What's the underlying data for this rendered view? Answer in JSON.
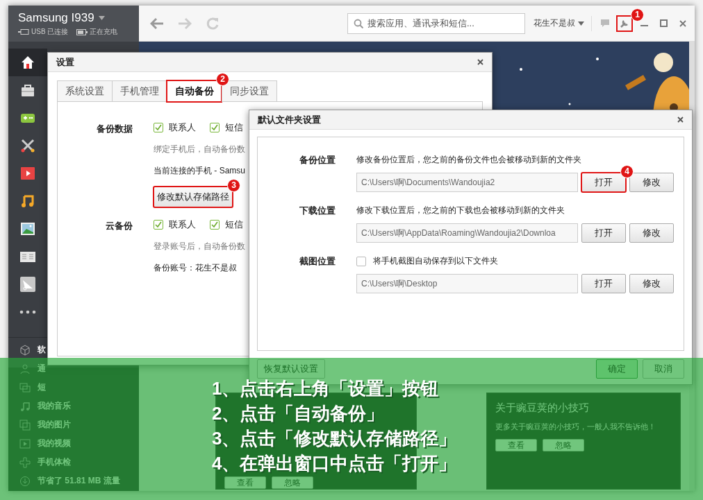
{
  "device": {
    "name": "Samsung I939",
    "usb_status": "USB 已连接",
    "charge_status": "正在充电"
  },
  "sidebar": {
    "nav": [
      {
        "selected": true
      },
      {
        "selected": false
      },
      {
        "selected": false
      },
      {
        "selected": false
      },
      {
        "selected": false
      },
      {
        "selected": false
      },
      {
        "selected": false
      },
      {
        "selected": false
      },
      {
        "selected": false
      },
      {
        "selected": false
      }
    ],
    "menu": [
      "软",
      "通",
      "短",
      "我的音乐",
      "我的图片",
      "我的视频",
      "手机体检"
    ],
    "traffic_saved": "节省了 51.81 MB 流量"
  },
  "home": {
    "card_buttons": [
      "查看",
      "忽略"
    ],
    "tip": {
      "title": "关于豌豆荚的小技巧",
      "text": "更多关于豌豆荚的小技巧，一般人我不告诉他！",
      "buttons": [
        "查看",
        "忽略"
      ]
    }
  },
  "toolbar": {
    "search": {
      "placeholder": "搜索应用、通讯录和短信..."
    },
    "account": "花生不是叔",
    "settings_button": {
      "callout": "1"
    }
  },
  "settings_dialog": {
    "title": "设置",
    "tabs": [
      {
        "label": "系统设置",
        "selected": false
      },
      {
        "label": "手机管理",
        "selected": false
      },
      {
        "label": "自动备份",
        "selected": true,
        "callout": "2"
      },
      {
        "label": "同步设置",
        "selected": false
      }
    ],
    "sections": [
      {
        "label": "备份数据",
        "options": [
          {
            "label": "联系人",
            "checked": true
          },
          {
            "label": "短信",
            "checked": true
          }
        ],
        "lines": [
          {
            "kind": "hint",
            "text": "绑定手机后，自动备份数"
          },
          {
            "kind": "info",
            "text": "当前连接的手机 - Samsu"
          }
        ],
        "button": {
          "label": "修改默认存储路径",
          "callout": "3"
        }
      },
      {
        "label": "云备份",
        "options": [
          {
            "label": "联系人",
            "checked": true
          },
          {
            "label": "短信",
            "checked": true
          }
        ],
        "lines": [
          {
            "kind": "hint",
            "text": "登录账号后，自动备份数"
          },
          {
            "kind": "info",
            "text": "备份账号：花生不是叔"
          }
        ]
      }
    ]
  },
  "folder_dialog": {
    "title": "默认文件夹设置",
    "rows": [
      {
        "label": "备份位置",
        "kind": "note",
        "note": "修改备份位置后，您之前的备份文件也会被移动到新的文件夹",
        "path": "C:\\Users\\啊\\Documents\\Wandoujia2",
        "open": {
          "label": "打开",
          "callout": "4"
        },
        "change": "修改"
      },
      {
        "label": "下载位置",
        "kind": "note",
        "note": "修改下载位置后，您之前的下载也会被移动到新的文件夹",
        "path": "C:\\Users\\啊\\AppData\\Roaming\\Wandoujia2\\Downloa",
        "open": {
          "label": "打开"
        },
        "change": "修改"
      },
      {
        "label": "截图位置",
        "kind": "checkbox",
        "checked": false,
        "note": "将手机截图自动保存到以下文件夹",
        "path": "C:\\Users\\啊\\Desktop",
        "open": {
          "label": "打开"
        },
        "change": "修改"
      }
    ],
    "footer": {
      "reset": "恢复默认设置",
      "ok": "确定",
      "cancel": "取消"
    }
  },
  "guide": {
    "steps": [
      "1、点击右上角「设置」按钮",
      "2、点击「自动备份」",
      "3、点击「修改默认存储路径」",
      "4、在弹出窗口中点击「打开」"
    ]
  }
}
